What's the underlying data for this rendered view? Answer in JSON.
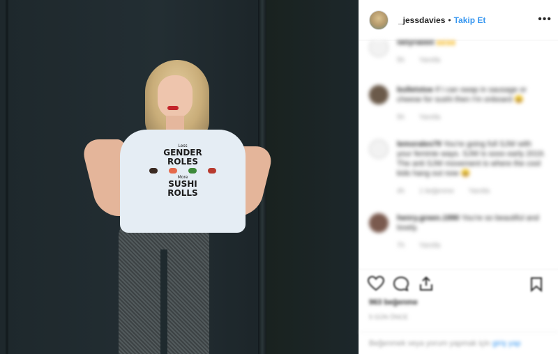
{
  "header": {
    "username": "_jessdavies",
    "separator": "•",
    "follow_label": "Takip Et",
    "more_label": "•••"
  },
  "photo": {
    "shirt_line1": "Less",
    "shirt_line2": "GENDER",
    "shirt_line3": "ROLES",
    "shirt_line4": "More",
    "shirt_line5": "SUSHI",
    "shirt_line6": "ROLLS"
  },
  "comments": [
    {
      "user": "fattyrabbit",
      "text": "🙌🙌",
      "time": "5h",
      "reply": "Yanıtla",
      "avatar_color": "#f2f2f2"
    },
    {
      "user": "bulletstoe",
      "text": "If I can swap in sausage or cheese for sushi then I'm onboard 😄",
      "time": "5h",
      "reply": "Yanıtla",
      "avatar_color": "#6b5a4a"
    },
    {
      "user": "lemorales79",
      "text": "You're going full SJW with your feminie ways. SJW is sooo early 2019. The anti SJW movement is where the cool kids hang out now 😄",
      "time": "4h",
      "likes": "1 beğenme",
      "reply": "Yanıtla",
      "avatar_color": "#f2f2f2"
    },
    {
      "user": "henry.green.1990",
      "text": "You're so beautiful and lovely.",
      "time": "7h",
      "reply": "Yanıtla",
      "avatar_color": "#7a5a4e"
    }
  ],
  "actions": {
    "heart_icon": "heart-icon",
    "comment_icon": "comment-icon",
    "share_icon": "share-icon",
    "bookmark_icon": "bookmark-icon"
  },
  "stats": {
    "likes": "963 beğenme",
    "time": "5 GÜN ÖNCE"
  },
  "add_comment": {
    "prefix": "Beğenmek veya yorum yapmak için ",
    "link": "giriş yap"
  }
}
